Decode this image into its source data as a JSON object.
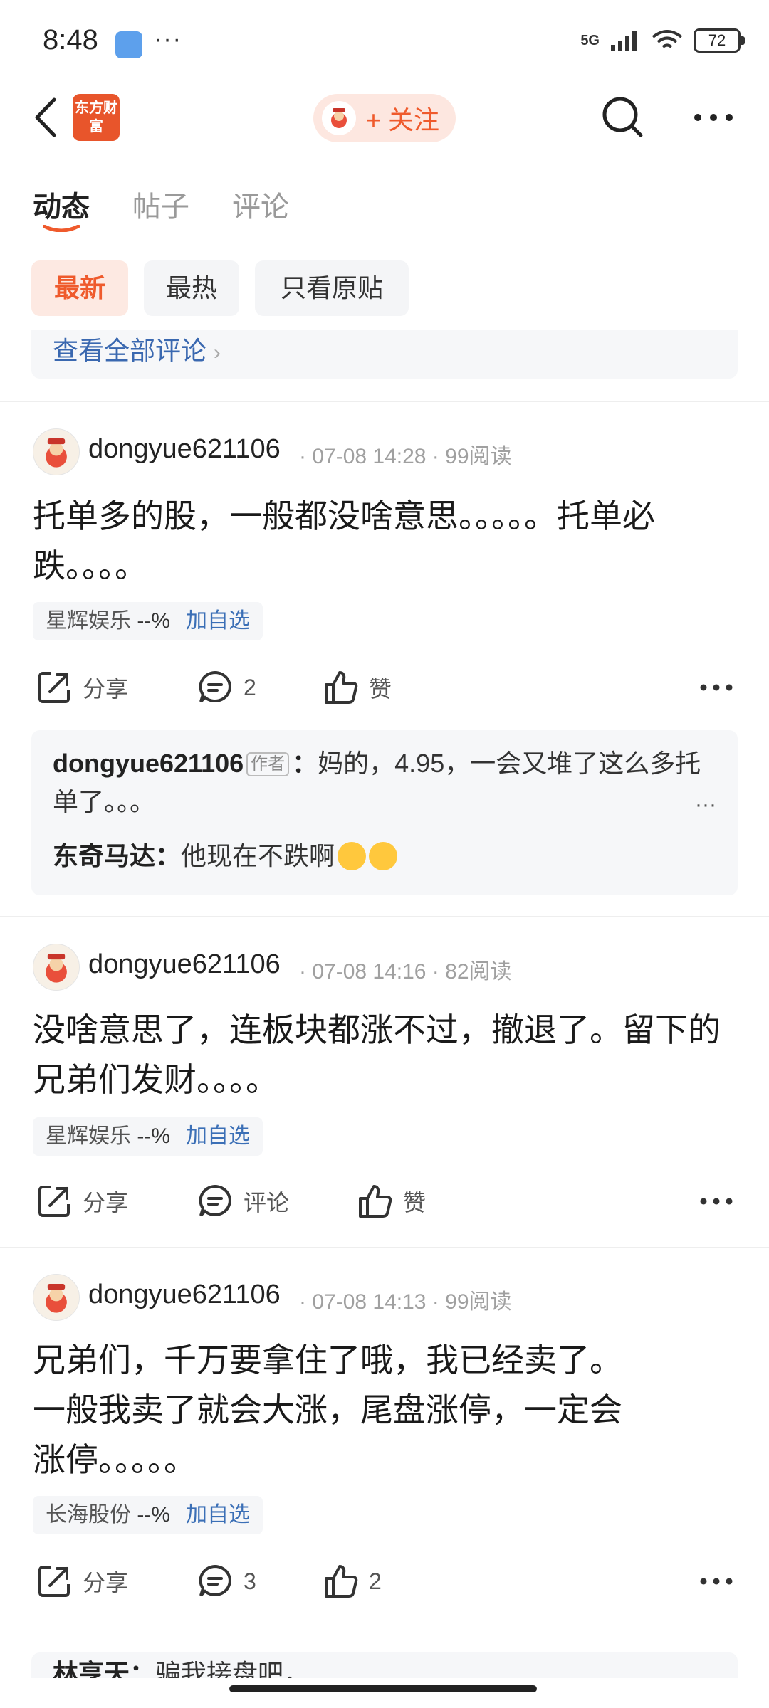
{
  "status": {
    "time": "8:48",
    "network": "5G",
    "battery": "72"
  },
  "header": {
    "logo_text": "东方财富",
    "follow_label": "+ 关注"
  },
  "tabs": [
    {
      "label": "动态",
      "active": true
    },
    {
      "label": "帖子",
      "active": false
    },
    {
      "label": "评论",
      "active": false
    }
  ],
  "filters": [
    {
      "label": "最新",
      "active": true
    },
    {
      "label": "最热",
      "active": false
    },
    {
      "label": "只看原贴",
      "active": false
    }
  ],
  "view_all_comments": "查看全部评论",
  "posts": [
    {
      "author": "dongyue621106",
      "time": "07-08 14:28",
      "reads": "99阅读",
      "content": "托单多的股，一般都没啥意思。。。。。托单必跌。。。。",
      "stock": {
        "name": "星辉娱乐",
        "change": "--%",
        "add_label": "加自选"
      },
      "actions": {
        "share": "分享",
        "comment": "2",
        "like": "赞"
      },
      "replies": [
        {
          "name": "dongyue621106",
          "tag": "作者",
          "text": "妈的，4.95，一会又堆了这么多托单了。。。"
        },
        {
          "name": "东奇马达",
          "text": "他现在不跌啊"
        }
      ]
    },
    {
      "author": "dongyue621106",
      "time": "07-08 14:16",
      "reads": "82阅读",
      "content": "没啥意思了，连板块都涨不过，撤退了。留下的兄弟们发财。。。。",
      "stock": {
        "name": "星辉娱乐",
        "change": "--%",
        "add_label": "加自选"
      },
      "actions": {
        "share": "分享",
        "comment": "评论",
        "like": "赞"
      }
    },
    {
      "author": "dongyue621106",
      "time": "07-08 14:13",
      "reads": "99阅读",
      "content": "兄弟们，千万要拿住了哦，我已经卖了。一般我卖了就会大涨，尾盘涨停，一定会涨停。。。。。",
      "stock": {
        "name": "长海股份",
        "change": "--%",
        "add_label": "加自选"
      },
      "actions": {
        "share": "分享",
        "comment": "3",
        "like": "2"
      },
      "replies": [
        {
          "name": "林亨天",
          "text": "骗我接盘吧，"
        }
      ]
    }
  ],
  "colors": {
    "accent": "#ef5a2c",
    "link": "#3b6fb6",
    "divider": "#eeeeee"
  }
}
